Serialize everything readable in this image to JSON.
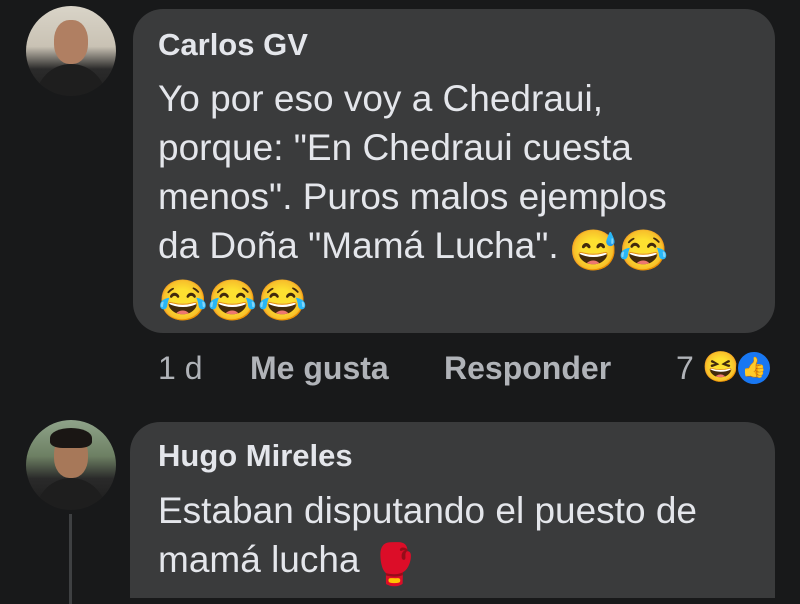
{
  "comments": [
    {
      "author": "Carlos GV",
      "lines": [
        "Yo por eso voy a Chedraui,",
        "porque: \"En Chedraui cuesta",
        "menos\". Puros malos ejemplos",
        "da Doña \"Mamá Lucha\". "
      ],
      "line4_emoji": "😅😂",
      "line5_emoji": "😂😂😂",
      "time": "1 d",
      "like_label": "Me gusta",
      "reply_label": "Responder",
      "reaction_count": "7",
      "reaction_icons": [
        "haha-reaction-icon",
        "like-reaction-icon"
      ]
    },
    {
      "author": "Hugo Mireles",
      "lines": [
        "Estaban disputando el puesto de",
        "mamá lucha "
      ],
      "line2_emoji": "🥊"
    }
  ],
  "colors": {
    "background": "#18191a",
    "bubble": "#3a3b3c",
    "text": "#e4e6eb",
    "secondary_text": "#b0b3b8",
    "like_blue": "#1877f2"
  }
}
